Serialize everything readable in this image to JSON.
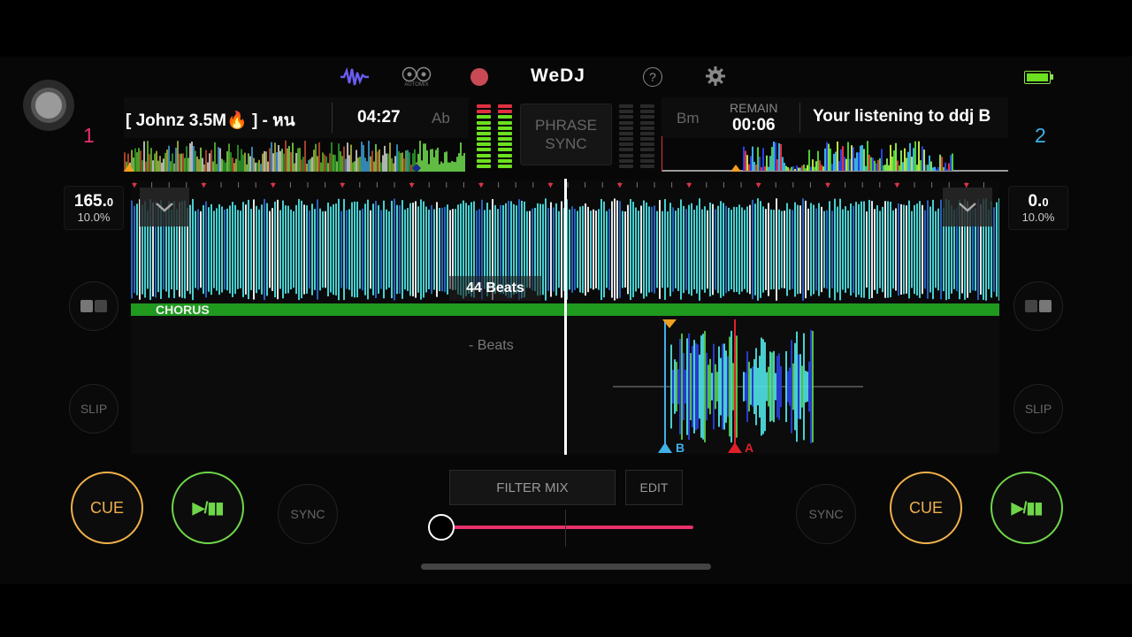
{
  "app": {
    "logo": "WeDJ",
    "automix_label": "AUTOMIX"
  },
  "deck1": {
    "number": "1",
    "title": "[ Johnz 3.5M🔥 ] - หน",
    "time": "04:27",
    "key": "Ab",
    "bpm_main": "165.",
    "bpm_dec": "0",
    "pitch": "10.0%",
    "phrase_label": "CHORUS",
    "beats_label": "44 Beats",
    "cue_label": "CUE",
    "play_label": "▶/▮▮",
    "sync_label": "SYNC",
    "slip_label": "SLIP",
    "color": "#e8306a"
  },
  "deck2": {
    "number": "2",
    "title": "Your listening to ddj B",
    "remain_label": "REMAIN",
    "remain_time": "00:06",
    "key": "Bm",
    "bpm_main": "0.",
    "bpm_dec": "0",
    "pitch": "10.0%",
    "beats_label": "- Beats",
    "cue_label": "CUE",
    "play_label": "▶/▮▮",
    "sync_label": "SYNC",
    "slip_label": "SLIP",
    "marker_b": "B",
    "marker_a": "A",
    "color": "#3fb0ea"
  },
  "center": {
    "phrase_line1": "PHRASE",
    "phrase_line2": "SYNC",
    "filter_mix_label": "FILTER MIX",
    "edit_label": "EDIT",
    "crossfader_position": 0.0
  },
  "icons": {
    "waveform": "waveform-icon",
    "automix": "automix-icon",
    "record": "record-icon",
    "help": "help-icon",
    "settings": "gear-icon",
    "battery": "battery-icon"
  },
  "colors": {
    "accent_pink": "#e8306a",
    "cue": "#f0b04a",
    "play": "#6fd64a",
    "wave": "#4fe3e6"
  }
}
